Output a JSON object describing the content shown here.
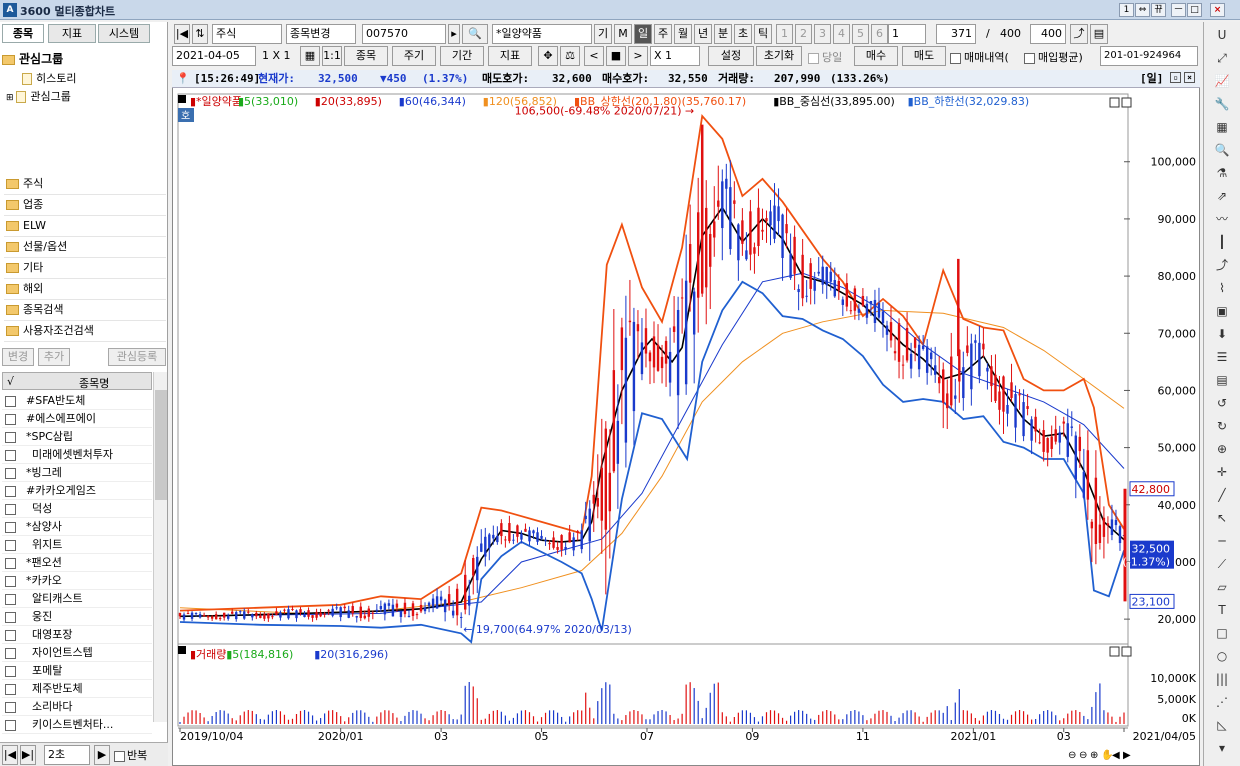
{
  "window": {
    "title": "3600 멀티종합차트",
    "buttons": [
      "1",
      "⇔",
      "뀨",
      "ㅡ",
      "□",
      "×"
    ]
  },
  "left": {
    "tabs": [
      "종목",
      "지표",
      "시스템"
    ],
    "tree": {
      "root": "관심그룹",
      "children": [
        "히스토리",
        "관심그룹"
      ]
    },
    "folders": [
      "주식",
      "업종",
      "ELW",
      "선물/옵션",
      "기타",
      "해외",
      "종목검색",
      "사용자조건검색"
    ],
    "actions": [
      "변경",
      "추가",
      "관심등록"
    ],
    "list_header": {
      "check": "√",
      "name": "종목명"
    },
    "stocks": [
      "#SFA반도체",
      "#에스에프에이",
      "*SPC삼립",
      "미래에셋벤처투자",
      "*빙그레",
      "#카카오게임즈",
      "덕성",
      "*삼양사",
      "위지트",
      "*팬오션",
      "*카카오",
      "알티캐스트",
      "웅진",
      "대영포장",
      "자이언트스텝",
      "포메탈",
      "제주반도체",
      "소리바다",
      "키이스트벤처타..."
    ],
    "bottom": {
      "interval": "2초",
      "repeat": "반복"
    }
  },
  "toolbar1": {
    "market": "주식",
    "change": "종목변경",
    "code": "007570",
    "name": "*일양약품",
    "periods": [
      "기",
      "M",
      "일",
      "주",
      "월",
      "년",
      "분",
      "초",
      "틱"
    ],
    "active_period": "일",
    "nums": [
      "1",
      "2",
      "3",
      "4",
      "5",
      "6"
    ],
    "num_sel": "1",
    "count": "371",
    "total": "400",
    "view": "400"
  },
  "toolbar2": {
    "date": "2021-04-05",
    "scale": "1 X 1",
    "stock": "종목",
    "cycle": "주기",
    "range": "기간",
    "indicator": "지표",
    "zoom": "X 1",
    "settings": "설정",
    "reset": "초기화",
    "today": "당일",
    "buy": "매수",
    "sell": "매도",
    "trade_hist": "매매내역(",
    "avg": "매입평균)",
    "acct": "201-01-924964"
  },
  "info": {
    "time": "[15:26:49]",
    "price_label": "현재가:",
    "price": "32,500",
    "change": "▼450",
    "pct": "(1.37%)",
    "ask_label": "매도호가:",
    "ask": "32,600",
    "bid_label": "매수호가:",
    "bid": "32,550",
    "vol_label": "거래량:",
    "vol": "207,990",
    "vol_pct": "(133.26%)",
    "period": "[일]"
  },
  "chart_data": {
    "type": "line",
    "legend": [
      {
        "name": "*일양약품",
        "color": "#cc0000"
      },
      {
        "name": "5(33,010)",
        "color": "#1aaa1a"
      },
      {
        "name": "20(33,895)",
        "color": "#cc0000"
      },
      {
        "name": "60(46,344)",
        "color": "#1a3acc"
      },
      {
        "name": "120(56,852)",
        "color": "#f09020"
      },
      {
        "name": "BB_상한선(20,1.80)(35,760.17)",
        "color": "#f05010"
      },
      {
        "name": "BB_중심선(33,895.00)",
        "color": "#000000"
      },
      {
        "name": "BB_하한선(32,029.83)",
        "color": "#2060d0"
      }
    ],
    "max_note": "106,500(-69.48% 2020/07/21)",
    "min_note": "19,700(64.97% 2020/03/13)",
    "yticks": [
      "100,000",
      "90,000",
      "80,000",
      "70,000",
      "60,000",
      "50,000",
      "40,000",
      "30,000",
      "20,000"
    ],
    "ylim": [
      16000,
      108000
    ],
    "price_tags": {
      "high": "42,800",
      "cur": "32,500",
      "cur_pct": "(-1.37%)",
      "low": "23,100"
    },
    "xticks": [
      "2019/10/04",
      "2020/01",
      "03",
      "05",
      "07",
      "09",
      "11",
      "2021/01",
      "03",
      "2021/04/05"
    ],
    "bb_mid": [
      [
        0,
        20500
      ],
      [
        40,
        20600
      ],
      [
        80,
        20800
      ],
      [
        120,
        21000
      ],
      [
        160,
        21200
      ],
      [
        200,
        21400
      ],
      [
        240,
        21800
      ],
      [
        280,
        23000
      ],
      [
        300,
        30500
      ],
      [
        320,
        35500
      ],
      [
        340,
        35000
      ],
      [
        360,
        33800
      ],
      [
        380,
        33500
      ],
      [
        400,
        33800
      ],
      [
        410,
        37000
      ],
      [
        420,
        47000
      ],
      [
        440,
        60000
      ],
      [
        460,
        67000
      ],
      [
        470,
        69000
      ],
      [
        490,
        65000
      ],
      [
        500,
        67500
      ],
      [
        520,
        87000
      ],
      [
        540,
        92000
      ],
      [
        560,
        86000
      ],
      [
        580,
        90000
      ],
      [
        600,
        86500
      ],
      [
        620,
        80000
      ],
      [
        640,
        79000
      ],
      [
        660,
        77000
      ],
      [
        680,
        75000
      ],
      [
        700,
        71500
      ],
      [
        720,
        68000
      ],
      [
        740,
        65500
      ],
      [
        760,
        62000
      ],
      [
        780,
        63000
      ],
      [
        800,
        66000
      ],
      [
        820,
        60000
      ],
      [
        840,
        55000
      ],
      [
        860,
        52000
      ],
      [
        880,
        52500
      ],
      [
        900,
        46000
      ],
      [
        920,
        37000
      ],
      [
        940,
        33895
      ]
    ],
    "bb_up": [
      [
        0,
        21500
      ],
      [
        80,
        22000
      ],
      [
        160,
        22500
      ],
      [
        200,
        24000
      ],
      [
        240,
        23500
      ],
      [
        280,
        28000
      ],
      [
        300,
        39500
      ],
      [
        320,
        39000
      ],
      [
        360,
        37000
      ],
      [
        400,
        35000
      ],
      [
        410,
        45000
      ],
      [
        425,
        82000
      ],
      [
        440,
        89000
      ],
      [
        460,
        78000
      ],
      [
        480,
        72000
      ],
      [
        500,
        85000
      ],
      [
        520,
        108000
      ],
      [
        540,
        104000
      ],
      [
        560,
        94000
      ],
      [
        580,
        97000
      ],
      [
        600,
        93000
      ],
      [
        620,
        88000
      ],
      [
        640,
        83000
      ],
      [
        660,
        79000
      ],
      [
        680,
        73000
      ],
      [
        700,
        76000
      ],
      [
        720,
        73000
      ],
      [
        740,
        68000
      ],
      [
        760,
        81000
      ],
      [
        780,
        72500
      ],
      [
        800,
        71000
      ],
      [
        820,
        70500
      ],
      [
        840,
        62000
      ],
      [
        860,
        60000
      ],
      [
        880,
        60000
      ],
      [
        900,
        62000
      ],
      [
        910,
        57000
      ],
      [
        925,
        40000
      ],
      [
        940,
        35760
      ]
    ],
    "bb_low": [
      [
        0,
        19500
      ],
      [
        80,
        19000
      ],
      [
        160,
        18800
      ],
      [
        200,
        18500
      ],
      [
        240,
        19000
      ],
      [
        280,
        17500
      ],
      [
        290,
        16000
      ],
      [
        300,
        27000
      ],
      [
        320,
        31000
      ],
      [
        340,
        33500
      ],
      [
        380,
        30000
      ],
      [
        400,
        28000
      ],
      [
        410,
        23500
      ],
      [
        420,
        18000
      ],
      [
        440,
        41000
      ],
      [
        460,
        56000
      ],
      [
        480,
        55000
      ],
      [
        505,
        48000
      ],
      [
        520,
        65000
      ],
      [
        540,
        74000
      ],
      [
        560,
        79000
      ],
      [
        580,
        77000
      ],
      [
        600,
        73000
      ],
      [
        620,
        72500
      ],
      [
        640,
        70500
      ],
      [
        660,
        69000
      ],
      [
        680,
        66000
      ],
      [
        700,
        61000
      ],
      [
        720,
        58000
      ],
      [
        740,
        58500
      ],
      [
        760,
        58000
      ],
      [
        780,
        55000
      ],
      [
        800,
        55500
      ],
      [
        820,
        51000
      ],
      [
        840,
        50000
      ],
      [
        860,
        48000
      ],
      [
        880,
        48000
      ],
      [
        900,
        42000
      ],
      [
        910,
        25000
      ],
      [
        925,
        24000
      ],
      [
        940,
        32030
      ]
    ],
    "ma60": [
      [
        0,
        20500
      ],
      [
        200,
        21000
      ],
      [
        300,
        23000
      ],
      [
        340,
        30000
      ],
      [
        380,
        32000
      ],
      [
        420,
        34000
      ],
      [
        460,
        42000
      ],
      [
        500,
        55000
      ],
      [
        540,
        68000
      ],
      [
        580,
        79000
      ],
      [
        620,
        80500
      ],
      [
        660,
        78000
      ],
      [
        700,
        74000
      ],
      [
        740,
        68000
      ],
      [
        780,
        63000
      ],
      [
        820,
        60500
      ],
      [
        860,
        58000
      ],
      [
        900,
        54000
      ],
      [
        940,
        46344
      ]
    ],
    "ma120": [
      [
        0,
        22000
      ],
      [
        120,
        21000
      ],
      [
        200,
        21500
      ],
      [
        280,
        23000
      ],
      [
        340,
        25500
      ],
      [
        400,
        28500
      ],
      [
        440,
        35000
      ],
      [
        480,
        45000
      ],
      [
        520,
        58000
      ],
      [
        560,
        65000
      ],
      [
        600,
        70000
      ],
      [
        640,
        72000
      ],
      [
        700,
        74000
      ],
      [
        760,
        73500
      ],
      [
        820,
        71000
      ],
      [
        860,
        67000
      ],
      [
        900,
        62000
      ],
      [
        940,
        56852
      ]
    ]
  },
  "volume": {
    "legend": [
      {
        "name": "거래량",
        "color": "#cc0000"
      },
      {
        "name": "5(184,816)",
        "color": "#1aaa1a"
      },
      {
        "name": "20(316,296)",
        "color": "#1a3acc"
      }
    ],
    "yticks": [
      "10,000K",
      "5,000K",
      "0K"
    ]
  }
}
